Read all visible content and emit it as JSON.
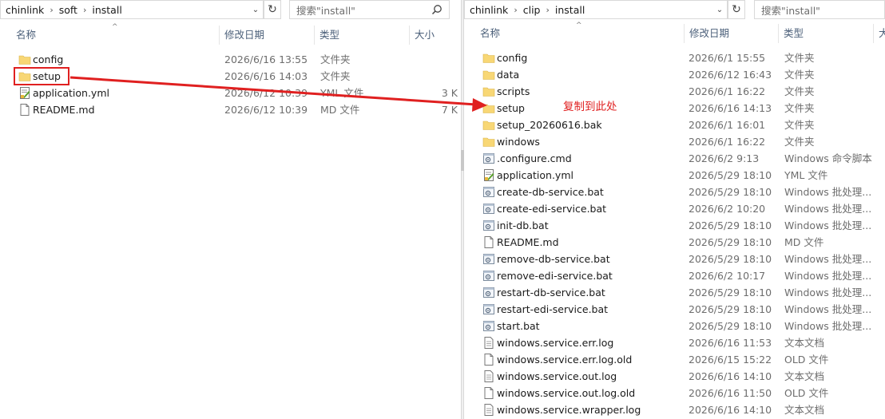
{
  "left_window": {
    "breadcrumbs": [
      "chinlink",
      "soft",
      "install"
    ],
    "search_placeholder": "搜索\"install\"",
    "columns": [
      "名称",
      "修改日期",
      "类型",
      "大小"
    ],
    "files": [
      {
        "name": "config",
        "date": "2026/6/16 13:55",
        "type": "文件夹",
        "size": "",
        "icon": "folder-icon"
      },
      {
        "name": "setup",
        "date": "2026/6/16 14:03",
        "type": "文件夹",
        "size": "",
        "icon": "folder-icon"
      },
      {
        "name": "application.yml",
        "date": "2026/6/12 10:39",
        "type": "YML 文件",
        "size": "3 K",
        "icon": "yml-file-icon"
      },
      {
        "name": "README.md",
        "date": "2026/6/12 10:39",
        "type": "MD 文件",
        "size": "7 K",
        "icon": "document-icon"
      }
    ]
  },
  "right_window": {
    "breadcrumbs": [
      "chinlink",
      "clip",
      "install"
    ],
    "search_placeholder": "搜索\"install\"",
    "columns": [
      "名称",
      "修改日期",
      "类型",
      "大"
    ],
    "files": [
      {
        "name": "config",
        "date": "2026/6/1 15:55",
        "type": "文件夹",
        "icon": "folder-icon"
      },
      {
        "name": "data",
        "date": "2026/6/12 16:43",
        "type": "文件夹",
        "icon": "folder-icon"
      },
      {
        "name": "scripts",
        "date": "2026/6/1 16:22",
        "type": "文件夹",
        "icon": "folder-icon"
      },
      {
        "name": "setup",
        "date": "2026/6/16 14:13",
        "type": "文件夹",
        "icon": "folder-icon"
      },
      {
        "name": "setup_20260616.bak",
        "date": "2026/6/1 16:01",
        "type": "文件夹",
        "icon": "folder-icon"
      },
      {
        "name": "windows",
        "date": "2026/6/1 16:22",
        "type": "文件夹",
        "icon": "folder-icon"
      },
      {
        "name": ".configure.cmd",
        "date": "2026/6/2 9:13",
        "type": "Windows 命令脚本",
        "icon": "script-icon"
      },
      {
        "name": "application.yml",
        "date": "2026/5/29 18:10",
        "type": "YML 文件",
        "icon": "yml-file-icon"
      },
      {
        "name": "create-db-service.bat",
        "date": "2026/5/29 18:10",
        "type": "Windows 批处理...",
        "icon": "script-icon"
      },
      {
        "name": "create-edi-service.bat",
        "date": "2026/6/2 10:20",
        "type": "Windows 批处理...",
        "icon": "script-icon"
      },
      {
        "name": "init-db.bat",
        "date": "2026/5/29 18:10",
        "type": "Windows 批处理...",
        "icon": "script-icon"
      },
      {
        "name": "README.md",
        "date": "2026/5/29 18:10",
        "type": "MD 文件",
        "icon": "document-icon"
      },
      {
        "name": "remove-db-service.bat",
        "date": "2026/5/29 18:10",
        "type": "Windows 批处理...",
        "icon": "script-icon"
      },
      {
        "name": "remove-edi-service.bat",
        "date": "2026/6/2 10:17",
        "type": "Windows 批处理...",
        "icon": "script-icon"
      },
      {
        "name": "restart-db-service.bat",
        "date": "2026/5/29 18:10",
        "type": "Windows 批处理...",
        "icon": "script-icon"
      },
      {
        "name": "restart-edi-service.bat",
        "date": "2026/5/29 18:10",
        "type": "Windows 批处理...",
        "icon": "script-icon"
      },
      {
        "name": "start.bat",
        "date": "2026/5/29 18:10",
        "type": "Windows 批处理...",
        "icon": "script-icon"
      },
      {
        "name": "windows.service.err.log",
        "date": "2026/6/16 11:53",
        "type": "文本文档",
        "icon": "text-file-icon"
      },
      {
        "name": "windows.service.err.log.old",
        "date": "2026/6/15 15:22",
        "type": "OLD 文件",
        "icon": "document-icon"
      },
      {
        "name": "windows.service.out.log",
        "date": "2026/6/16 14:10",
        "type": "文本文档",
        "icon": "text-file-icon"
      },
      {
        "name": "windows.service.out.log.old",
        "date": "2026/6/16 11:50",
        "type": "OLD 文件",
        "icon": "document-icon"
      },
      {
        "name": "windows.service.wrapper.log",
        "date": "2026/6/16 14:10",
        "type": "文本文档",
        "icon": "text-file-icon"
      }
    ]
  },
  "annotation": {
    "callout_text": "复制到此处",
    "color": "#e02020"
  },
  "colors": {
    "folder": "#f8d775",
    "header_text": "#4c607a",
    "muted_text": "#6d6d6d"
  }
}
